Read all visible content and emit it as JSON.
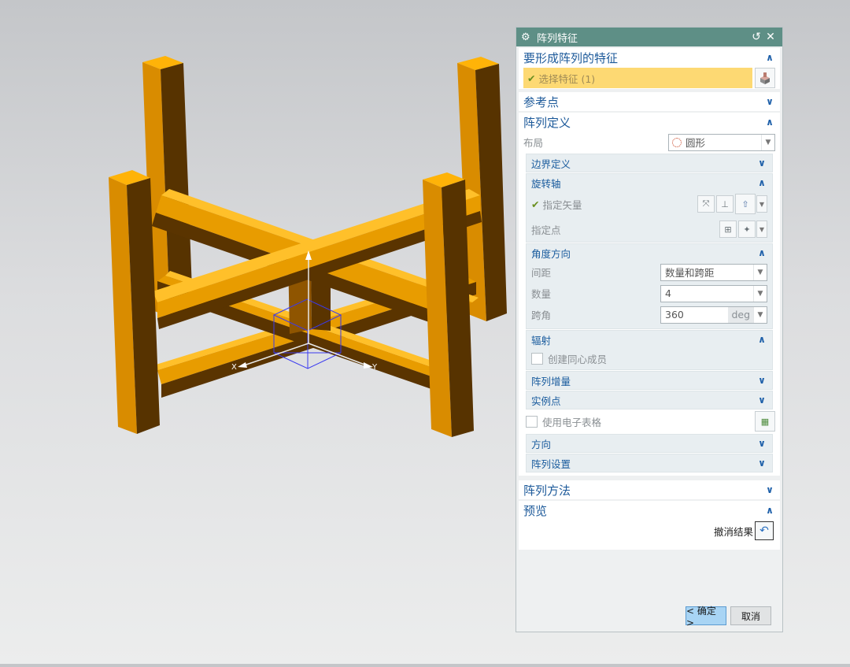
{
  "dialog": {
    "title": "阵列特征",
    "title_icon": "gear-icon",
    "reset_glyph": "↺",
    "close_glyph": "✕"
  },
  "groups": {
    "features": {
      "header": "要形成阵列的特征",
      "select_label": "选择特征 (1)",
      "check_glyph": "✔"
    },
    "ref_point": {
      "header": "参考点"
    },
    "pattern_def": {
      "header": "阵列定义",
      "layout_label": "布局",
      "layout_value": "圆形",
      "boundary": {
        "header": "边界定义"
      },
      "rot_axis": {
        "header": "旋转轴",
        "vector_label": "指定矢量",
        "point_label": "指定点"
      },
      "angle_dir": {
        "header": "角度方向",
        "spacing_label": "间距",
        "spacing_value": "数量和跨距",
        "count_label": "数量",
        "count_value": "4",
        "span_label": "跨角",
        "span_value": "360",
        "span_unit": "deg"
      },
      "radiate": {
        "header": "辐射",
        "concentric_label": "创建同心成员"
      },
      "increment": {
        "header": "阵列增量"
      },
      "instance_pt": {
        "header": "实例点"
      },
      "spreadsheet_label": "使用电子表格",
      "orientation": {
        "header": "方向"
      },
      "settings": {
        "header": "阵列设置"
      }
    },
    "method": {
      "header": "阵列方法"
    },
    "preview": {
      "header": "预览",
      "undo_label": "撤消结果"
    }
  },
  "footer": {
    "ok_label": "< 确定 >",
    "cancel_label": "取消"
  },
  "viewport": {
    "axis_x_label": "X",
    "axis_y_label": "Y",
    "part_color": "#f5a800"
  },
  "chevrons": {
    "up": "∧",
    "down": "∨"
  }
}
